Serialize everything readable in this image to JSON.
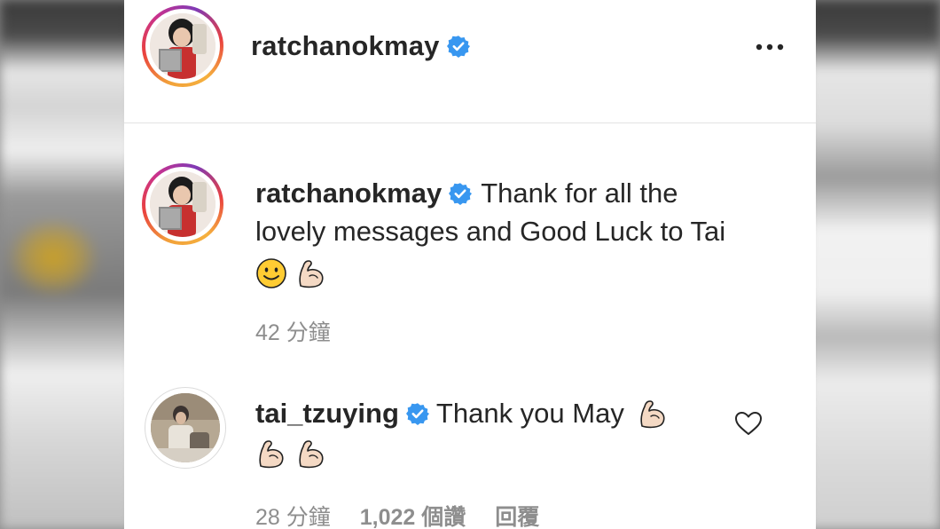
{
  "post": {
    "author": {
      "username": "ratchanokmay",
      "verified": true
    },
    "more_icon": "more-options-icon"
  },
  "comments": [
    {
      "username": "ratchanokmay",
      "verified": true,
      "text_line1": "Thank for all the",
      "text_line2": "lovely messages and Good Luck to Tai",
      "emojis": [
        "slightly-smiling-face",
        "flexed-biceps"
      ],
      "time": "42 分鐘"
    },
    {
      "username": "tai_tzuying",
      "verified": true,
      "text": "Thank you May",
      "emojis": [
        "flexed-biceps",
        "flexed-biceps",
        "flexed-biceps"
      ],
      "time": "28 分鐘",
      "likes": "1,022 個讚",
      "reply": "回覆"
    }
  ],
  "colors": {
    "text": "#262626",
    "secondary": "#8e8e8e",
    "verified": "#3897f0",
    "divider": "#e3e3e3"
  }
}
